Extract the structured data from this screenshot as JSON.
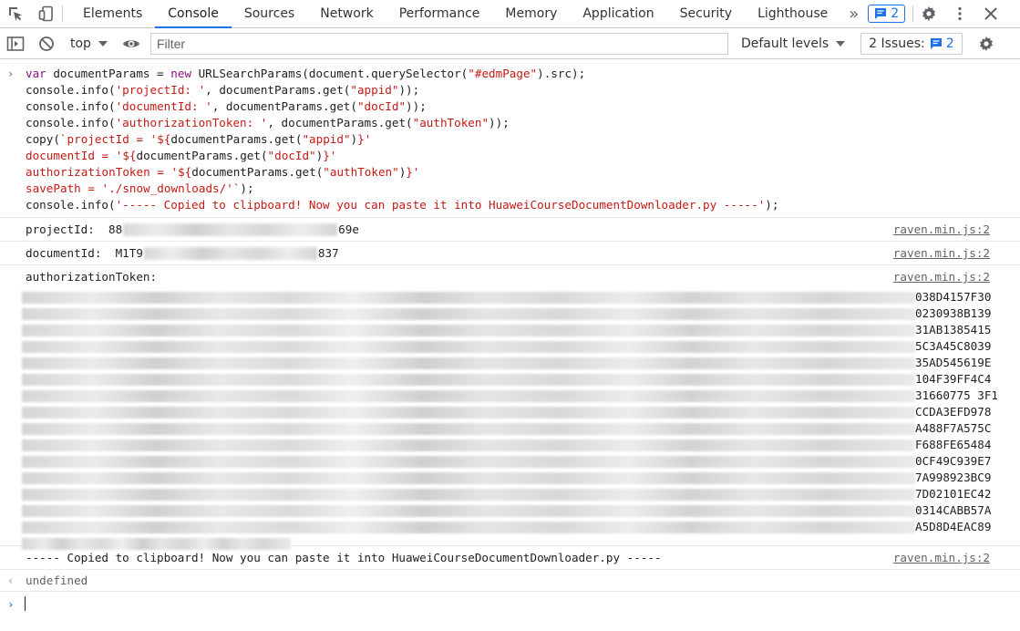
{
  "tabs": [
    "Elements",
    "Console",
    "Sources",
    "Network",
    "Performance",
    "Memory",
    "Application",
    "Security",
    "Lighthouse"
  ],
  "active_tab": "Console",
  "more_tabs_glyph": "»",
  "message_badge_count": "2",
  "toolbar": {
    "context": "top",
    "filter_placeholder": "Filter",
    "levels": "Default levels",
    "issues_label": "2 Issues:",
    "issues_count": "2"
  },
  "code_lines": [
    "var documentParams = new URLSearchParams(document.querySelector(\"#edmPage\").src);",
    "console.info('projectId: ', documentParams.get(\"appid\"));",
    "console.info('documentId: ', documentParams.get(\"docId\"));",
    "console.info('authorizationToken: ', documentParams.get(\"authToken\"));",
    "copy(`projectId = '${documentParams.get(\"appid\")}'",
    "documentId = '${documentParams.get(\"docId\")}'",
    "authorizationToken = '${documentParams.get(\"authToken\")}'",
    "savePath = './snow_downloads/'`);",
    "console.info('----- Copied to clipboard! Now you can paste it into HuaweiCourseDocumentDownloader.py -----');"
  ],
  "logs": {
    "project": {
      "label": "projectId:",
      "prefix": "88",
      "suffix": "69e",
      "source": "raven.min.js:2"
    },
    "document": {
      "label": "documentId:",
      "prefix": "M1T9",
      "suffix": "837",
      "source": "raven.min.js:2"
    },
    "auth": {
      "label": "authorizationToken:",
      "source": "raven.min.js:2",
      "token_line_ends": [
        "038D4157F30",
        "0230938B139",
        "31AB1385415",
        "5C3A45C8039",
        "35AD545619E",
        "104F39FF4C4",
        "31660775 3F1",
        "CCDA3EFD978",
        "A488F7A575C",
        "F688FE65484",
        "0CF49C939E7",
        "7A998923BC9",
        "7D02101EC42",
        "0314CABB57A",
        "A5D8D4EAC89"
      ]
    },
    "copied": {
      "text": "----- Copied to clipboard! Now you can paste it into HuaweiCourseDocumentDownloader.py -----",
      "source": "raven.min.js:2"
    }
  },
  "result": "undefined",
  "colors": {
    "accent": "#1a73e8",
    "keyword": "#881280",
    "string": "#c41a16"
  }
}
